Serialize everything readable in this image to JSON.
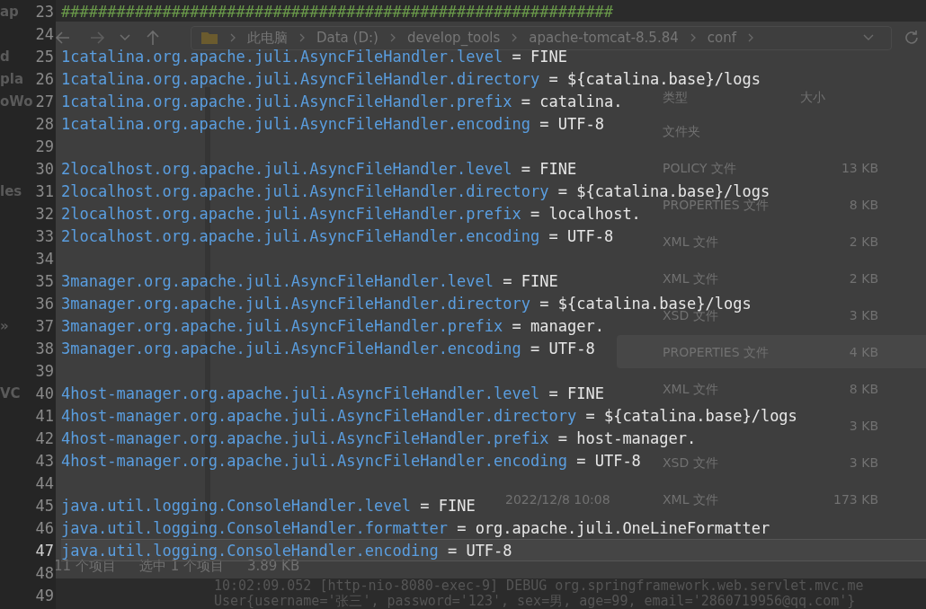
{
  "editor": {
    "lines": [
      {
        "number": "23",
        "kind": "comment",
        "text": "############################################################",
        "tree_text": "ap",
        "current": false
      },
      {
        "number": "24",
        "kind": "blank",
        "current": false
      },
      {
        "number": "25",
        "kind": "property",
        "key": "1catalina.org.apache.juli.AsyncFileHandler.level",
        "sep": "=",
        "value": "FINE",
        "tree_text": "d",
        "current": false
      },
      {
        "number": "26",
        "kind": "property",
        "key": "1catalina.org.apache.juli.AsyncFileHandler.directory",
        "sep": "=",
        "value": "${catalina.base}/logs",
        "tree_text": "pla",
        "current": false
      },
      {
        "number": "27",
        "kind": "property",
        "key": "1catalina.org.apache.juli.AsyncFileHandler.prefix",
        "sep": "=",
        "value": "catalina.",
        "tree_text": "oWo",
        "current": false
      },
      {
        "number": "28",
        "kind": "property",
        "key": "1catalina.org.apache.juli.AsyncFileHandler.encoding",
        "sep": "=",
        "value": "UTF-8",
        "current": false
      },
      {
        "number": "29",
        "kind": "blank",
        "current": false
      },
      {
        "number": "30",
        "kind": "property",
        "key": "2localhost.org.apache.juli.AsyncFileHandler.level",
        "sep": "=",
        "value": "FINE",
        "current": false
      },
      {
        "number": "31",
        "kind": "property",
        "key": "2localhost.org.apache.juli.AsyncFileHandler.directory",
        "sep": "=",
        "value": "${catalina.base}/logs",
        "tree_text": "les",
        "current": false
      },
      {
        "number": "32",
        "kind": "property",
        "key": "2localhost.org.apache.juli.AsyncFileHandler.prefix",
        "sep": "=",
        "value": "localhost.",
        "current": false
      },
      {
        "number": "33",
        "kind": "property",
        "key": "2localhost.org.apache.juli.AsyncFileHandler.encoding",
        "sep": "=",
        "value": "UTF-8",
        "current": false
      },
      {
        "number": "34",
        "kind": "blank",
        "current": false
      },
      {
        "number": "35",
        "kind": "property",
        "key": "3manager.org.apache.juli.AsyncFileHandler.level",
        "sep": "=",
        "value": "FINE",
        "current": false
      },
      {
        "number": "36",
        "kind": "property",
        "key": "3manager.org.apache.juli.AsyncFileHandler.directory",
        "sep": "=",
        "value": "${catalina.base}/logs",
        "current": false
      },
      {
        "number": "37",
        "kind": "property",
        "key": "3manager.org.apache.juli.AsyncFileHandler.prefix",
        "sep": "=",
        "value": "manager.",
        "tree_text": "»",
        "current": false
      },
      {
        "number": "38",
        "kind": "property",
        "key": "3manager.org.apache.juli.AsyncFileHandler.encoding",
        "sep": "=",
        "value": "UTF-8",
        "current": false
      },
      {
        "number": "39",
        "kind": "blank",
        "current": false
      },
      {
        "number": "40",
        "kind": "property",
        "key": "4host-manager.org.apache.juli.AsyncFileHandler.level",
        "sep": "=",
        "value": "FINE",
        "tree_text": "VC",
        "current": false
      },
      {
        "number": "41",
        "kind": "property",
        "key": "4host-manager.org.apache.juli.AsyncFileHandler.directory",
        "sep": "=",
        "value": "${catalina.base}/logs",
        "current": false
      },
      {
        "number": "42",
        "kind": "property",
        "key": "4host-manager.org.apache.juli.AsyncFileHandler.prefix",
        "sep": "=",
        "value": "host-manager.",
        "current": false
      },
      {
        "number": "43",
        "kind": "property",
        "key": "4host-manager.org.apache.juli.AsyncFileHandler.encoding",
        "sep": "=",
        "value": "UTF-8",
        "current": false
      },
      {
        "number": "44",
        "kind": "blank",
        "current": false
      },
      {
        "number": "45",
        "kind": "property",
        "key": "java.util.logging.ConsoleHandler.level",
        "sep": "=",
        "value": "FINE",
        "current": false
      },
      {
        "number": "46",
        "kind": "property",
        "key": "java.util.logging.ConsoleHandler.formatter",
        "sep": "=",
        "value": "org.apache.juli.OneLineFormatter",
        "current": false
      },
      {
        "number": "47",
        "kind": "property",
        "key": "java.util.logging.ConsoleHandler.encoding",
        "sep": "=",
        "value": "UTF-8",
        "current": true
      },
      {
        "number": "48",
        "kind": "blank",
        "current": false
      },
      {
        "number": "49",
        "kind": "blank",
        "current": false
      }
    ]
  },
  "console": {
    "lines": [
      "10:02:09.052 [http-nio-8080-exec-9] DEBUG org.springframework.web.servlet.mvc.me",
      "User{username='张三', password='123', sex=男, age=99, email='2860719956@qq.com'}"
    ]
  },
  "explorer": {
    "breadcrumb": [
      "此电脑",
      "Data (D:)",
      "develop_tools",
      "apache-tomcat-8.5.84",
      "conf"
    ],
    "table": {
      "columns": [
        "类型",
        "大小"
      ],
      "rows": [
        {
          "type": "文件夹",
          "selected": false
        },
        {
          "type": "POLICY 文件",
          "size": "13 KB",
          "selected": false
        },
        {
          "type": "PROPERTIES 文件",
          "size": "8 KB",
          "selected": false
        },
        {
          "type": "XML 文件",
          "size": "2 KB",
          "selected": false
        },
        {
          "type": "XML 文件",
          "size": "2 KB",
          "selected": false
        },
        {
          "type": "XSD 文件",
          "size": "3 KB",
          "selected": false
        },
        {
          "type": "PROPERTIES 文件",
          "size": "4 KB",
          "selected": true
        },
        {
          "type": "XML 文件",
          "size": "8 KB",
          "selected": false
        },
        {
          "size": "3 KB",
          "selected": false
        },
        {
          "type": "XSD 文件",
          "size": "3 KB",
          "selected": false
        },
        {
          "date": "2022/12/8 10:08",
          "type": "XML 文件",
          "size": "173 KB",
          "selected": false
        }
      ]
    },
    "status_bar": {
      "item_count": "11 个项目",
      "selection": "选中 1 个项目",
      "size": "3.89 KB"
    }
  }
}
